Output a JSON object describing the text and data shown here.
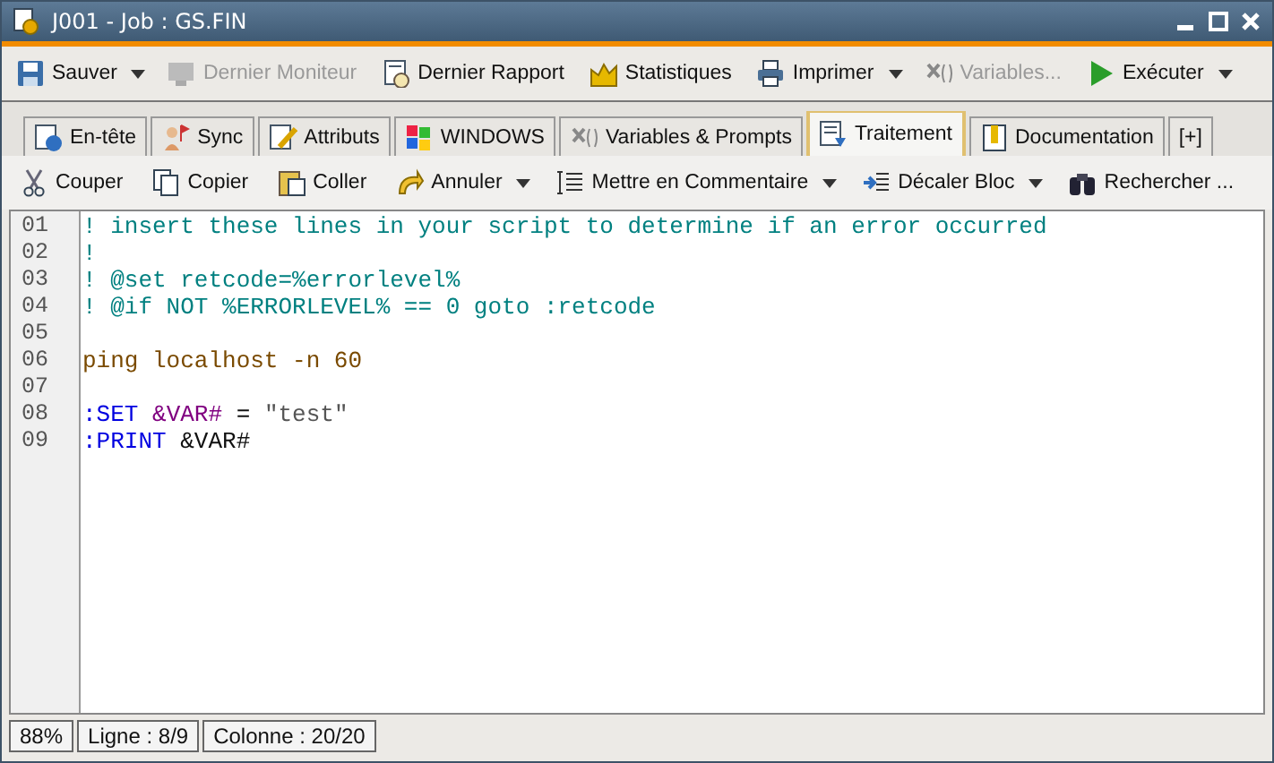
{
  "window": {
    "title": "J001 - Job : GS.FIN"
  },
  "toolbar": [
    {
      "label": "Sauver",
      "dropdown": true,
      "disabled": false
    },
    {
      "label": "Dernier Moniteur",
      "dropdown": false,
      "disabled": true
    },
    {
      "label": "Dernier Rapport",
      "dropdown": false,
      "disabled": false
    },
    {
      "label": "Statistiques",
      "dropdown": false,
      "disabled": false
    },
    {
      "label": "Imprimer",
      "dropdown": true,
      "disabled": false
    },
    {
      "label": "Variables...",
      "dropdown": false,
      "disabled": true
    },
    {
      "label": "Exécuter",
      "dropdown": true,
      "disabled": false
    }
  ],
  "tabs": [
    {
      "label": "En-tête",
      "selected": false
    },
    {
      "label": "Sync",
      "selected": false
    },
    {
      "label": "Attributs",
      "selected": false
    },
    {
      "label": "WINDOWS",
      "selected": false
    },
    {
      "label": "Variables & Prompts",
      "selected": false
    },
    {
      "label": "Traitement",
      "selected": true
    },
    {
      "label": "Documentation",
      "selected": false
    },
    {
      "label": "[+]",
      "selected": false
    }
  ],
  "edit_toolbar": [
    {
      "label": "Couper",
      "dropdown": false
    },
    {
      "label": "Copier",
      "dropdown": false
    },
    {
      "label": "Coller",
      "dropdown": false
    },
    {
      "label": "Annuler",
      "dropdown": true
    },
    {
      "label": "Mettre en Commentaire",
      "dropdown": true
    },
    {
      "label": "Décaler Bloc",
      "dropdown": true
    },
    {
      "label": "Rechercher ...",
      "dropdown": false
    }
  ],
  "editor": {
    "lines": [
      {
        "number": "01",
        "tokens": [
          {
            "kind": "comment",
            "text": "! insert these lines in your script to determine if an error occurred"
          }
        ]
      },
      {
        "number": "02",
        "tokens": [
          {
            "kind": "comment",
            "text": "!"
          }
        ]
      },
      {
        "number": "03",
        "tokens": [
          {
            "kind": "comment",
            "text": "! @set retcode=%errorlevel%"
          }
        ]
      },
      {
        "number": "04",
        "tokens": [
          {
            "kind": "comment",
            "text": "! @if NOT %ERRORLEVEL% == 0 goto :retcode"
          }
        ]
      },
      {
        "number": "05"
      },
      {
        "number": "06",
        "tokens": [
          {
            "kind": "command",
            "text": "ping localhost -n 60"
          }
        ]
      },
      {
        "number": "07"
      },
      {
        "number": "08",
        "tokens": [
          {
            "kind": "keyword",
            "text": ":SET"
          },
          {
            "kind": "variable",
            "text": " &VAR#"
          },
          {
            "kind": "plain",
            "text": " = "
          },
          {
            "kind": "string",
            "text": "\"test\""
          }
        ]
      },
      {
        "number": "09",
        "tokens": [
          {
            "kind": "keyword",
            "text": ":PRINT"
          },
          {
            "kind": "plain",
            "text": " &VAR#"
          }
        ]
      }
    ]
  },
  "status_bar": [
    "88%",
    "Ligne : 8/9",
    "Colonne : 20/20"
  ]
}
